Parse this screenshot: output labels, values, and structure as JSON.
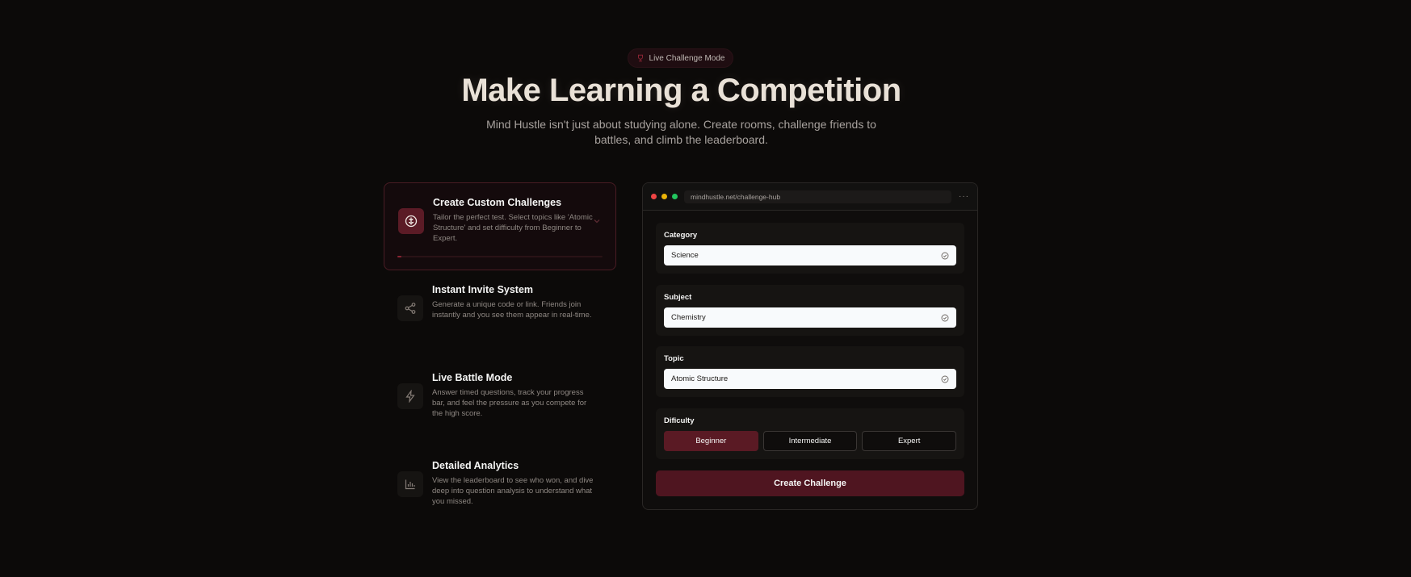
{
  "badge": {
    "label": "Live Challenge Mode",
    "icon": "trophy-icon"
  },
  "hero": {
    "title": "Make Learning a Competition",
    "subtitle": "Mind Hustle isn't just about studying alone. Create rooms, challenge friends to battles, and climb the leaderboard."
  },
  "features": [
    {
      "title": "Create Custom Challenges",
      "description": "Tailor the perfect test. Select topics like 'Atomic Structure' and set difficulty from Beginner to Expert.",
      "icon": "brain-icon",
      "active": true,
      "progress": 0.02
    },
    {
      "title": "Instant Invite System",
      "description": "Generate a unique code or link. Friends join instantly and you see them appear in real-time.",
      "icon": "share-icon",
      "active": false
    },
    {
      "title": "Live Battle Mode",
      "description": "Answer timed questions, track your progress bar, and feel the pressure as you compete for the high score.",
      "icon": "lightning-icon",
      "active": false
    },
    {
      "title": "Detailed Analytics",
      "description": "View the leaderboard to see who won, and dive deep into question analysis to understand what you missed.",
      "icon": "bar-chart-icon",
      "active": false
    }
  ],
  "window": {
    "url": "mindhustle.net/challenge-hub",
    "more_label": "···",
    "category": {
      "label": "Category",
      "value": "Science"
    },
    "subject": {
      "label": "Subject",
      "value": "Chemistry"
    },
    "topic": {
      "label": "Topic",
      "value": "Atomic Structure"
    },
    "difficulty": {
      "label": "Dificulty",
      "options": [
        "Beginner",
        "Intermediate",
        "Expert"
      ],
      "selected": "Beginner"
    },
    "create_label": "Create Challenge"
  },
  "colors": {
    "background": "#0c0a09",
    "accent": "#5a1a24",
    "button": "#4f1520",
    "dot_red": "#ef4444",
    "dot_yellow": "#eab308",
    "dot_green": "#22c55e"
  }
}
